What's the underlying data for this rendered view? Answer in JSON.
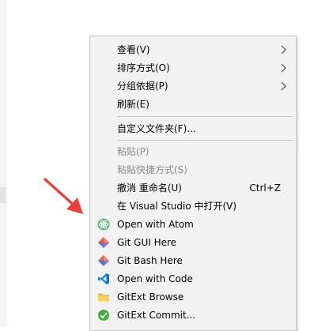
{
  "context_menu": {
    "view": "查看(V)",
    "sort": "排序方式(O)",
    "group": "分组依据(P)",
    "refresh": "刷新(E)",
    "customize": "自定义文件夹(F)...",
    "paste": "粘贴(P)",
    "paste_shortcut": "粘贴快捷方式(S)",
    "undo_rename": "撤消 重命名(U)",
    "undo_shortcut": "Ctrl+Z",
    "open_vs": "在 Visual Studio 中打开(V)",
    "open_atom": "Open with Atom",
    "git_gui": "Git GUI Here",
    "git_bash": "Git Bash Here",
    "open_code": "Open with Code",
    "gitext_browse": "GitExt Browse",
    "gitext_commit": "GitExt Commit..."
  },
  "colors": {
    "menu_bg": "#f2f2f2",
    "disabled_text": "#8a8a8a",
    "annotation_arrow": "#e8403a"
  },
  "icons": [
    "chevron-right-icon",
    "atom-icon",
    "git-icon",
    "vscode-icon",
    "folder-icon",
    "check-icon"
  ]
}
